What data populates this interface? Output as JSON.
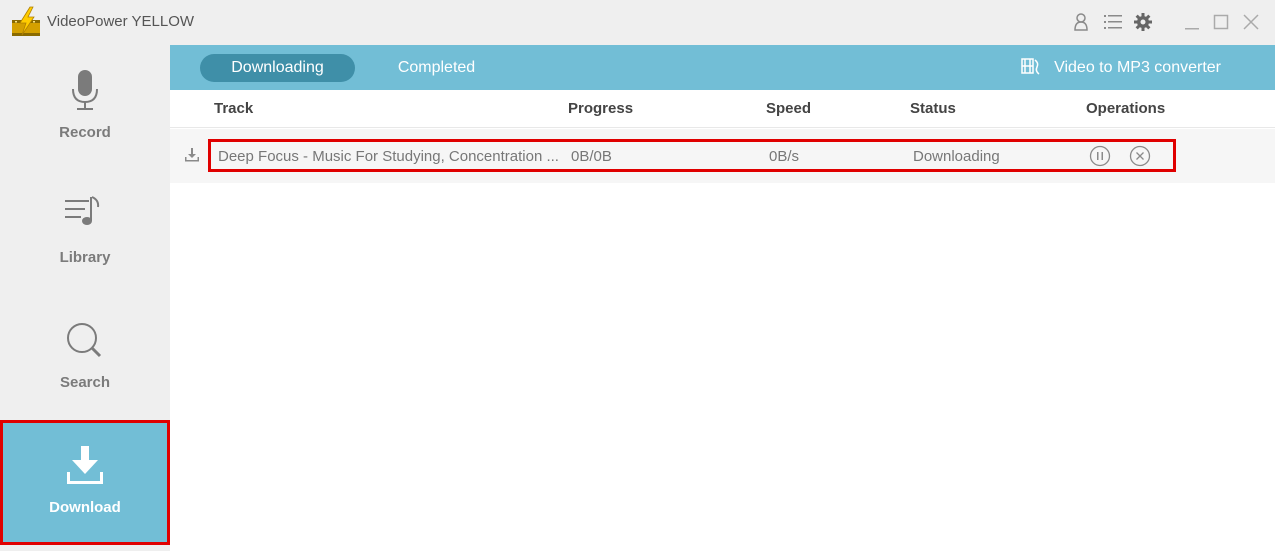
{
  "app": {
    "title": "VideoPower YELLOW",
    "logo_icon": "lightning-film-icon"
  },
  "titlebar": {
    "icons": [
      "user-icon",
      "menu-list-icon",
      "gear-icon",
      "minimize-icon",
      "maximize-icon",
      "close-icon"
    ]
  },
  "sidebar": {
    "items": [
      {
        "label": "Record",
        "icon": "microphone-icon",
        "active": false
      },
      {
        "label": "Library",
        "icon": "music-list-icon",
        "active": false
      },
      {
        "label": "Search",
        "icon": "search-icon",
        "active": false
      },
      {
        "label": "Download",
        "icon": "download-icon",
        "active": true
      }
    ]
  },
  "tabs": [
    {
      "label": "Downloading",
      "active": true
    },
    {
      "label": "Completed",
      "active": false
    }
  ],
  "converter": {
    "label": "Video to MP3 converter",
    "icon": "video-audio-convert-icon"
  },
  "table": {
    "columns": [
      "Track",
      "Progress",
      "Speed",
      "Status",
      "Operations"
    ],
    "rows": [
      {
        "track": "Deep Focus - Music For Studying, Concentration ...",
        "progress": "0B/0B",
        "speed": "0B/s",
        "status": "Downloading",
        "operations": [
          "pause-icon",
          "cancel-icon"
        ]
      }
    ]
  },
  "colors": {
    "accent": "#72bed6",
    "accent_dark": "#3f8fa8",
    "highlight": "#e00000",
    "sidebar_bg": "#efefef"
  }
}
